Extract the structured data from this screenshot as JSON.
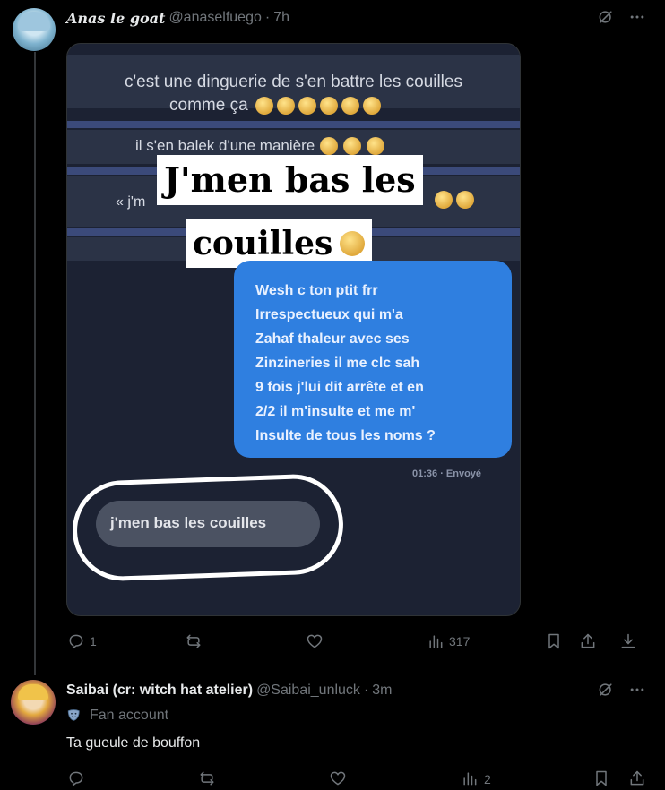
{
  "tweet": {
    "author_name": "Anas le goat",
    "handle": "@anaselfuego",
    "separator": "·",
    "time": "7h",
    "image": {
      "line1": "c'est une dinguerie de s'en battre les couilles",
      "line2": "comme ça",
      "line3": "il s'en balek d'une manière",
      "line4": "« j'm",
      "caption_top": "J'men bas les",
      "caption_bottom": "couilles",
      "blue_message": "Wesh c ton ptit frr\nIrrespectueux qui m'a\nZahaf thaleur avec ses\nZinzineries il me clc sah\n9 fois j'lui dit arrête et en\n2/2 il m'insulte et me m'\nInsulte de tous les noms ?",
      "sent_status": "01:36 · Envoyé",
      "grey_message": "j'men bas les couilles"
    },
    "actions": {
      "replies": "1",
      "retweets": "",
      "likes": "",
      "views": "317"
    }
  },
  "reply": {
    "author_name": "Saibai (cr: witch hat atelier)",
    "handle": "@Saibai_unluck",
    "separator": "·",
    "time": "3m",
    "badge": "Fan account",
    "text": "Ta gueule de bouffon",
    "actions": {
      "replies": "",
      "retweets": "",
      "likes": "",
      "views": "2"
    }
  },
  "colors": {
    "background": "#000000",
    "text": "#e7e9ea",
    "muted": "#71767b",
    "bubble_blue": "#2f7fe0"
  }
}
